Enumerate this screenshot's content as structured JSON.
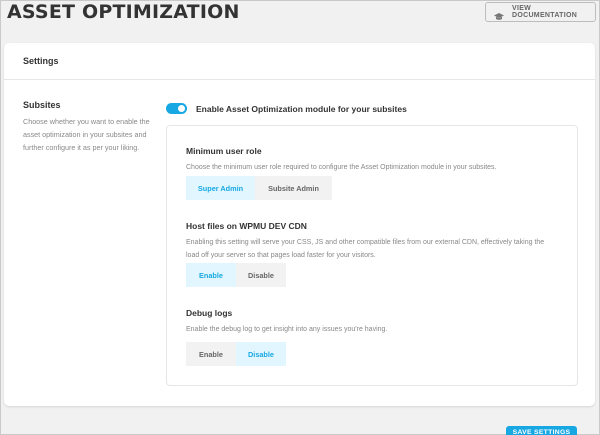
{
  "header": {
    "title": "ASSET OPTIMIZATION",
    "doc_button": {
      "label": "VIEW DOCUMENTATION",
      "icon": "graduation-cap-icon"
    }
  },
  "settings_box": {
    "title": "Settings",
    "subsites": {
      "title": "Subsites",
      "description": "Choose whether you want to enable the asset optimization in your subsites and further configure it as per your liking."
    },
    "toggle": {
      "label": "Enable Asset Optimization module for your subsites",
      "enabled": true
    },
    "options": {
      "min_role": {
        "title": "Minimum user role",
        "description": "Choose the minimum user role required to configure the Asset Optimization module in your subsites.",
        "buttons": [
          "Super Admin",
          "Subsite Admin"
        ],
        "selected": "Super Admin"
      },
      "cdn": {
        "title": "Host files on WPMU DEV CDN",
        "description": "Enabling this setting will serve your CSS, JS and other compatible files from our external CDN, effectively taking the load off your server so that pages load faster for your visitors.",
        "buttons": [
          "Enable",
          "Disable"
        ],
        "selected": "Enable"
      },
      "debug": {
        "title": "Debug logs",
        "description": "Enable the debug log to get insight into any issues you're having.",
        "buttons": [
          "Enable",
          "Disable"
        ],
        "selected": "Disable"
      }
    }
  },
  "save_button": {
    "label": "SAVE SETTINGS"
  },
  "colors": {
    "accent": "#17a8e3",
    "active_bg": "#e1f6ff",
    "page_bg": "#f1f1f1"
  }
}
